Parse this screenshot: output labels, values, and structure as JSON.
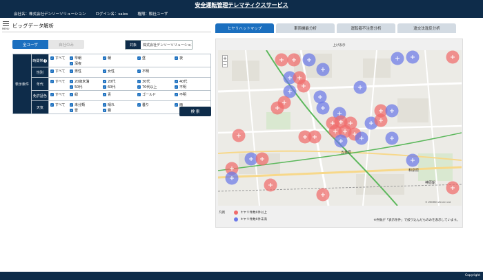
{
  "header": {
    "title": "安全運転管理テレマティクスサービス",
    "company": "会社名：株式会社デンソーソリューション",
    "login": "ログイン名：sales",
    "role": "権限：販社ユーザ"
  },
  "page": {
    "title": "ビッグデータ解析",
    "menu_label": "MENU"
  },
  "user_toggle": {
    "all_users": "全ユーザ",
    "own_company": "自社のみ"
  },
  "company_filter": {
    "label": "対象",
    "value": "株式会社デンソーソリューション"
  },
  "conditions": {
    "main_label": "表示条件",
    "rows": [
      {
        "label": "時間帯",
        "help": "?",
        "options": [
          "すべて",
          "早朝",
          "朝",
          "昼",
          "夜",
          "深夜"
        ]
      },
      {
        "label": "性別",
        "options": [
          "すべて",
          "男性",
          "女性",
          "不明"
        ]
      },
      {
        "label": "年代",
        "options": [
          "すべて",
          "20歳未満",
          "20代",
          "30代",
          "40代",
          "50代",
          "60代",
          "70代以上",
          "不明"
        ]
      },
      {
        "label": "免許証色",
        "options": [
          "すべて",
          "緑",
          "青",
          "ゴールド",
          "不明"
        ]
      },
      {
        "label": "天気",
        "options": [
          "すべて",
          "未分類",
          "晴れ",
          "曇り",
          "雨",
          "雪",
          "霧"
        ]
      }
    ],
    "checkmark": "✓"
  },
  "search_button": "検 索",
  "tabs": [
    "ヒヤリハットマップ",
    "車両機能分析",
    "運転者不注意分析",
    "違交法違反分析"
  ],
  "map": {
    "caption": "上げ表示",
    "zoom_in": "+",
    "zoom_out": "−",
    "labels": [
      "五条原",
      "和泉原",
      "神原駅"
    ],
    "attribution": "© ZENRIN Zenrin Ltd",
    "colors": {
      "red": "#f06b6b",
      "blue": "#6b78e8",
      "road_green": "#5cb85c"
    }
  },
  "legend": {
    "title": "凡例",
    "items": [
      {
        "label": "ヒヤリ件数6件以上",
        "color": "#f06b6b"
      },
      {
        "label": "ヒヤリ件数6件未満",
        "color": "#6b78e8"
      }
    ]
  },
  "note": "※件数が「表示条件」で絞り込んだものみを表示しています。",
  "footer": {
    "copyright": "Copyright"
  }
}
